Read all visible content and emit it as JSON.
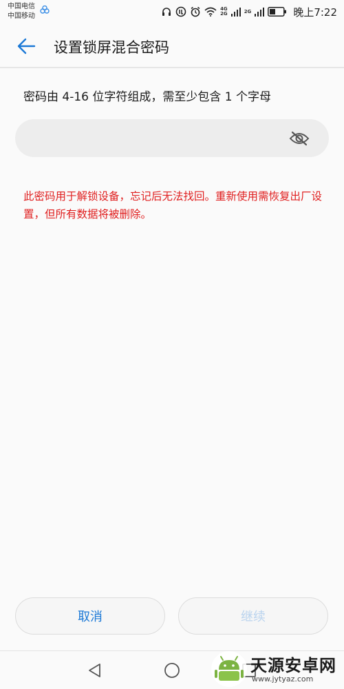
{
  "status_bar": {
    "carrier_1": "中国电信",
    "carrier_2": "中国移动",
    "network_1": "4G",
    "network_1_sub": "2G",
    "network_2": "2G",
    "time": "晚上7:22"
  },
  "header": {
    "title": "设置锁屏混合密码",
    "back_icon": "arrow-left-icon"
  },
  "content": {
    "instruction": "密码由 4-16 位字符组成，需至少包含 1 个字母",
    "password_value": "",
    "visibility_icon": "eye-off-icon",
    "warning": "此密码用于解锁设备，忘记后无法找回。重新使用需恢复出厂设置，但所有数据将被删除。"
  },
  "buttons": {
    "cancel": "取消",
    "continue": "继续"
  },
  "watermark": {
    "name": "天源安卓网",
    "url": "www.jytyaz.com"
  },
  "colors": {
    "accent": "#1a78d6",
    "accent_disabled": "#b9d3ee",
    "warning": "#e02020",
    "input_bg": "#ededed"
  }
}
